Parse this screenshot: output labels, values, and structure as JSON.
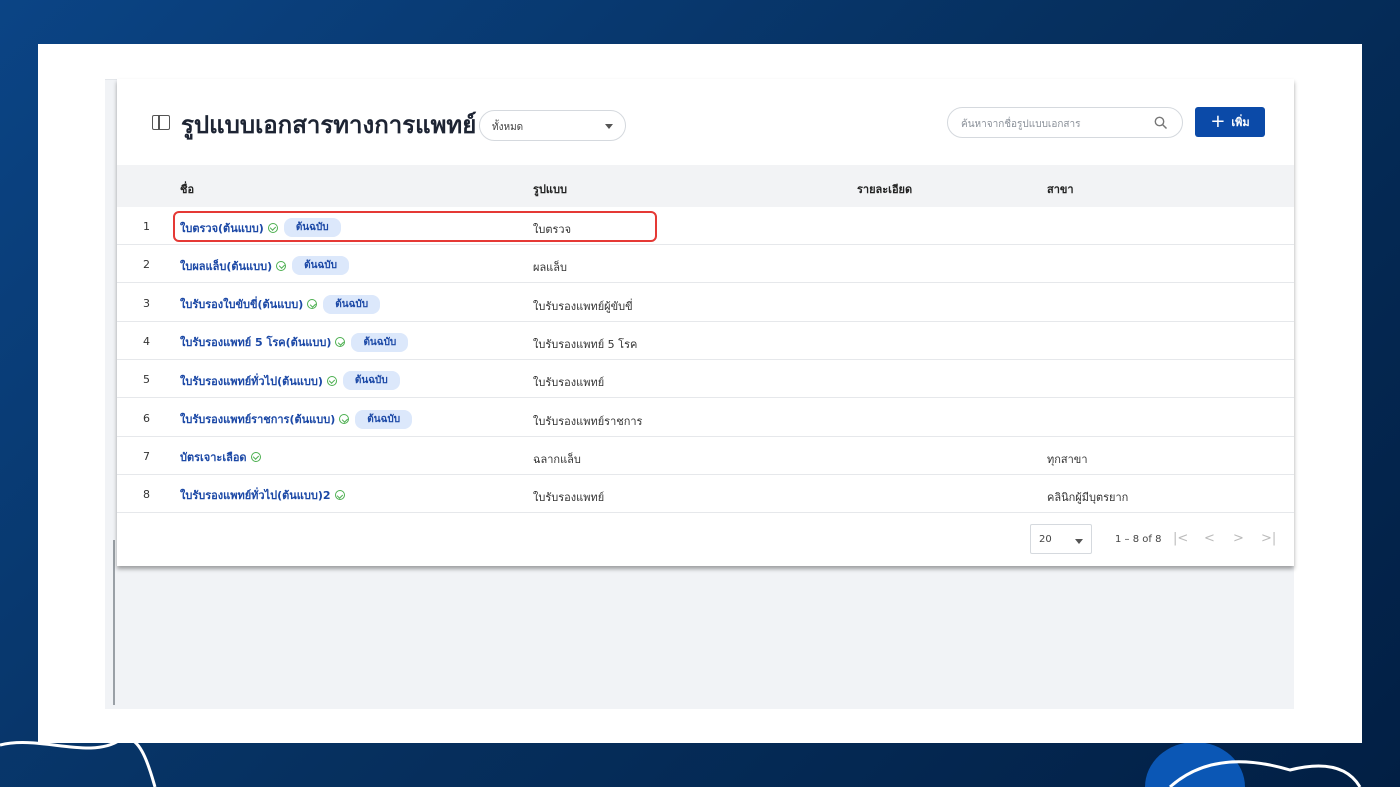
{
  "header": {
    "title": "รูปแบบเอกสารทางการแพทย์",
    "filter_value": "ทั้งหมด",
    "search_placeholder": "ค้นหาจากชื่อรูปแบบเอกสาร",
    "add_label": "เพิ่ม"
  },
  "table": {
    "columns": [
      "ชื่อ",
      "รูปแบบ",
      "รายละเอียด",
      "สาขา"
    ],
    "rows": [
      {
        "no": "1",
        "name": "ใบตรวจ(ต้นแบบ)",
        "badge": "ต้นฉบับ",
        "format": "ใบตรวจ",
        "detail": "",
        "branch": ""
      },
      {
        "no": "2",
        "name": "ใบผลแล็บ(ต้นแบบ)",
        "badge": "ต้นฉบับ",
        "format": "ผลแล็บ",
        "detail": "",
        "branch": ""
      },
      {
        "no": "3",
        "name": "ใบรับรองใบขับขี่(ต้นแบบ)",
        "badge": "ต้นฉบับ",
        "format": "ใบรับรองแพทย์ผู้ขับขี่",
        "detail": "",
        "branch": ""
      },
      {
        "no": "4",
        "name": "ใบรับรองแพทย์ 5 โรค(ต้นแบบ)",
        "badge": "ต้นฉบับ",
        "format": "ใบรับรองแพทย์ 5 โรค",
        "detail": "",
        "branch": ""
      },
      {
        "no": "5",
        "name": "ใบรับรองแพทย์ทั่วไป(ต้นแบบ)",
        "badge": "ต้นฉบับ",
        "format": "ใบรับรองแพทย์",
        "detail": "",
        "branch": ""
      },
      {
        "no": "6",
        "name": "ใบรับรองแพทย์ราชการ(ต้นแบบ)",
        "badge": "ต้นฉบับ",
        "format": "ใบรับรองแพทย์ราชการ",
        "detail": "",
        "branch": ""
      },
      {
        "no": "7",
        "name": "บัตรเจาะเลือด",
        "badge": null,
        "format": "ฉลากแล็บ",
        "detail": "",
        "branch": "ทุกสาขา"
      },
      {
        "no": "8",
        "name": "ใบรับรองแพทย์ทั่วไป(ต้นแบบ)2",
        "badge": null,
        "format": "ใบรับรองแพทย์",
        "detail": "",
        "branch": "คลินิกผู้มีบุตรยาก"
      }
    ]
  },
  "pagination": {
    "page_size": "20",
    "range": "1 – 8 of 8",
    "first": "|<",
    "prev": "<",
    "next": ">",
    "last": ">|"
  },
  "colors": {
    "accent": "#0b4aa8",
    "link": "#1b48a6",
    "highlight": "#e53935"
  }
}
